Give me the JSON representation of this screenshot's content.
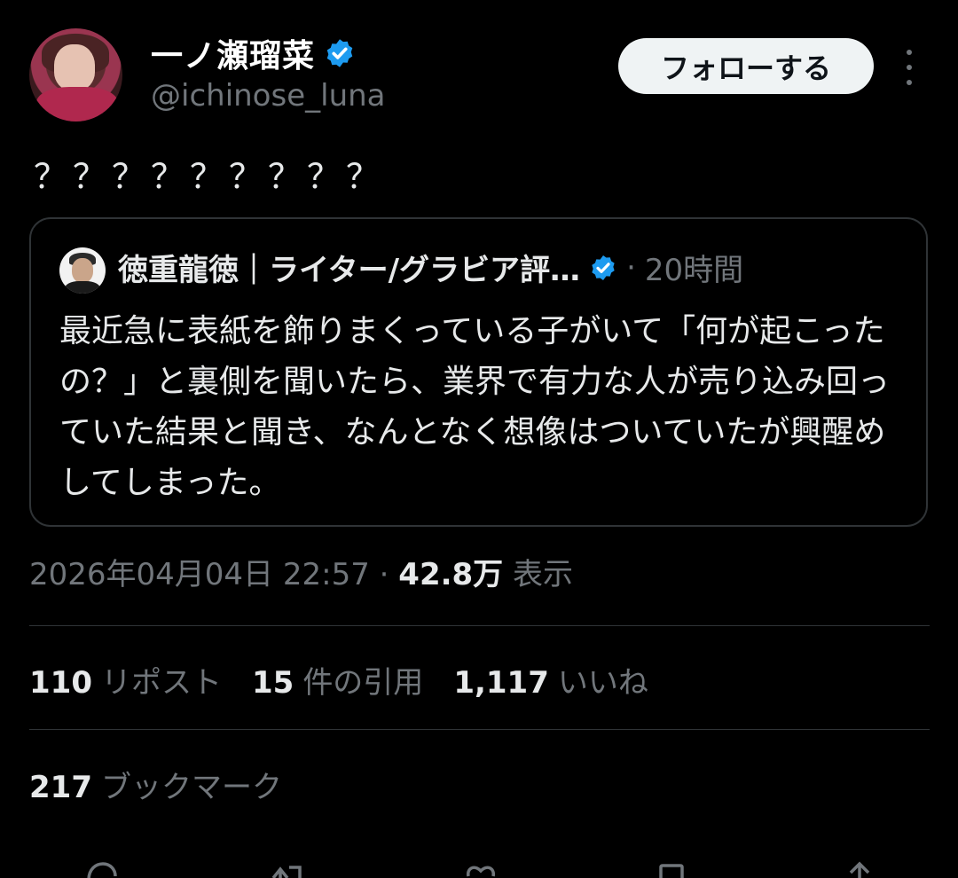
{
  "author": {
    "display_name": "一ノ瀬瑠菜",
    "handle": "@ichinose_luna",
    "follow_label": "フォローする"
  },
  "tweet": {
    "text": "？？？？？？？？？"
  },
  "quote": {
    "author_name": "徳重龍徳｜ライター/グラビア評…",
    "separator": "·",
    "time": "20時間",
    "body": "最近急に表紙を飾りまくっている子がいて「何が起こったの？」と裏側を聞いたら、業界で有力な人が売り込み回っていた結果と聞き、なんとなく想像はついていたが興醒めしてしまった。"
  },
  "meta": {
    "timestamp": "2026年04月04日 22:57",
    "separator": "·",
    "views_count": "42.8万",
    "views_label": "表示"
  },
  "stats": {
    "reposts_count": "110",
    "reposts_label": "リポスト",
    "quotes_count": "15",
    "quotes_label": "件の引用",
    "likes_count": "1,117",
    "likes_label": "いいね",
    "bookmarks_count": "217",
    "bookmarks_label": "ブックマーク"
  },
  "colors": {
    "background": "#000000",
    "text": "#e7e9ea",
    "secondary": "#71767b",
    "verified": "#1d9bf0",
    "border": "#2f3336"
  },
  "icons": [
    "more-icon",
    "verified-badge-icon",
    "reply-icon",
    "repost-icon",
    "like-icon",
    "bookmark-icon",
    "share-icon"
  ]
}
